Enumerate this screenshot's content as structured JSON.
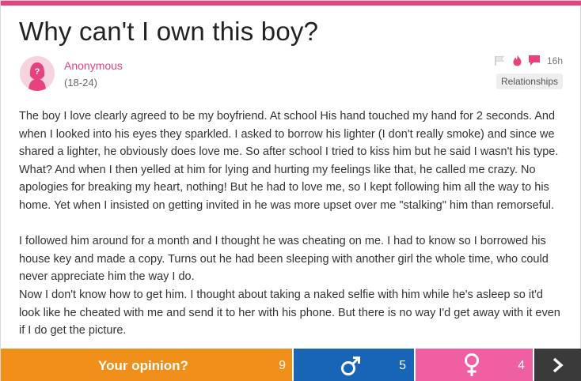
{
  "question": {
    "title": "Why can't I own this boy?",
    "author": "Anonymous",
    "age_range": "(18-24)",
    "time_ago": "16h",
    "category": "Relationships",
    "paragraphs": [
      "The boy I love clearly agreed to be my boyfriend. At school His hand touched my hand for 2 seconds. And when I looked into his eyes they sparkled. I asked to borrow his lighter (I don't really smoke) and since we shared a lighter, he obviously does love me. So after school I tried to kiss him but he said I wasn't his type. What? And when I then yelled at him for lying and hurting my feelings like that, he called me crazy. No apologies for breaking my heart, nothing! But he had to love me, so I kept following him all the way to his home. Yet when I insisted on getting invited in he was more upset over me \"stalking\" him than remorseful.",
      "I followed him around for a month and I thought he was cheating on me. I had to know so I borrowed his house key and made a copy. Turns out he had been sleeping with another girl the whole time, who could never appreciate him the way I do.",
      "Now I don't know how to get him. I thought about taking a naked selfie with him while he's asleep so it'd look like he cheated with me and send it to her with his phone. But there is no way I'd get away with it even if I do get the picture."
    ]
  },
  "icons": {
    "flag": "flag-icon",
    "fire": "fire-icon",
    "comment": "comment-icon",
    "avatar": "anonymous-female-avatar",
    "male": "male-symbol-icon",
    "female": "female-symbol-icon",
    "next": "chevron-right-icon"
  },
  "actions": {
    "opinion_label": "Your opinion?",
    "opinion_count": "9",
    "male_count": "5",
    "female_count": "4"
  },
  "colors": {
    "accent_pink": "#e6427f",
    "opinion_orange": "#f0901b",
    "male_blue": "#1864b6",
    "female_pink": "#ef5fa2",
    "next_dark": "#3a3a3a"
  }
}
